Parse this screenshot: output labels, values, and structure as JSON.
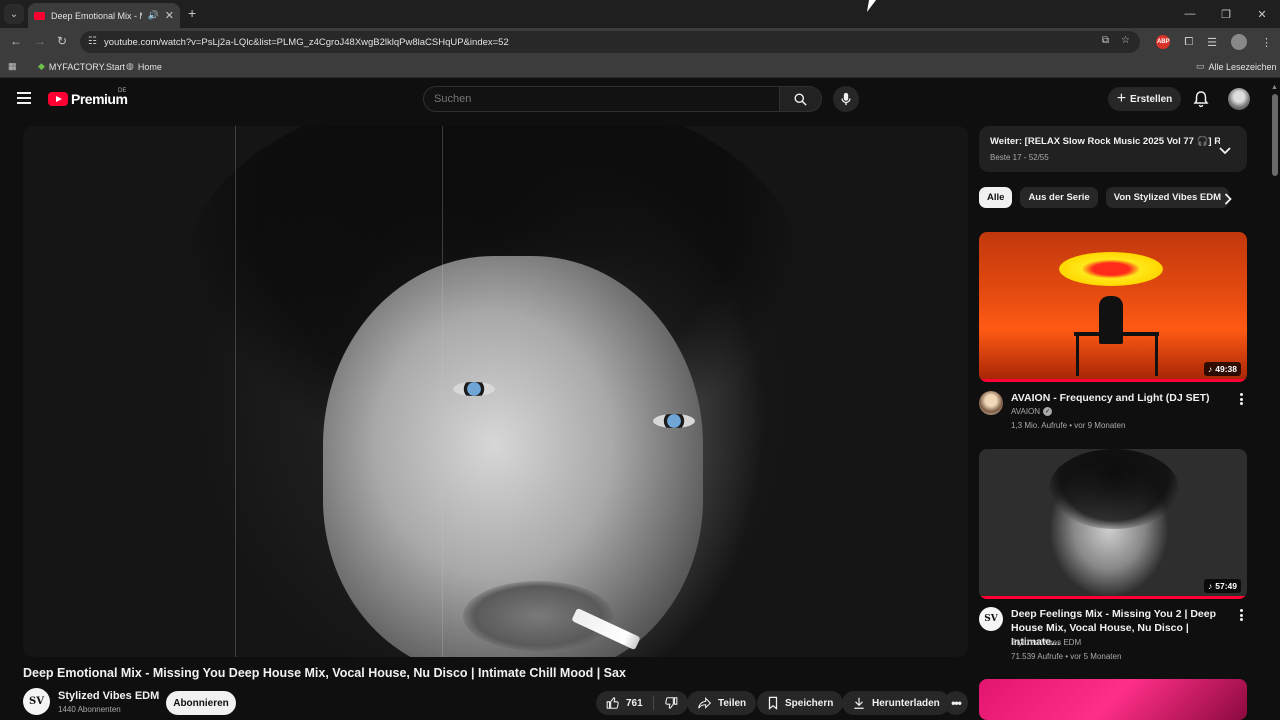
{
  "browser": {
    "tab_title": "Deep Emotional Mix - Missi",
    "url": "youtube.com/watch?v=PsLj2a-LQlc&list=PLMG_z4CgroJ48XwgB2lklqPw8laCSHqUP&index=52",
    "bookmarks": [
      "MYFACTORY.Start",
      "Home"
    ],
    "all_bookmarks_label": "Alle Lesezeichen",
    "extension_badge": "ABP"
  },
  "header": {
    "logo_text": "Premium",
    "logo_region": "DE",
    "search_placeholder": "Suchen",
    "create_label": "Erstellen"
  },
  "video": {
    "title": "Deep Emotional Mix - Missing You Deep House Mix, Vocal House, Nu Disco | Intimate Chill Mood | Sax",
    "channel": "Stylized Vibes EDM",
    "channel_initials": "SV",
    "subscribers": "1440 Abonnenten",
    "subscribe_label": "Abonnieren",
    "likes": "761",
    "share_label": "Teilen",
    "save_label": "Speichern",
    "download_label": "Herunterladen"
  },
  "playlist": {
    "title": "Weiter: [RELAX Slow Rock Music 2025 Vol 77 🎧] R...",
    "subtitle": "Beste 17 - 52/55"
  },
  "chips": [
    "Alle",
    "Aus der Serie",
    "Von Stylized Vibes EDM"
  ],
  "recommendations": [
    {
      "title": "AVAION - Frequency and Light (DJ SET)",
      "channel": "AVAION",
      "meta": "1,3 Mio. Aufrufe • vor 9 Monaten",
      "duration": "49:38"
    },
    {
      "title": "Deep Feelings Mix - Missing You 2 | Deep House Mix, Vocal House, Nu Disco | Intimate...",
      "channel": "Stylized Vibes EDM",
      "channel_initials": "SV",
      "meta": "71.539 Aufrufe • vor 5 Monaten",
      "duration": "57:49"
    }
  ]
}
